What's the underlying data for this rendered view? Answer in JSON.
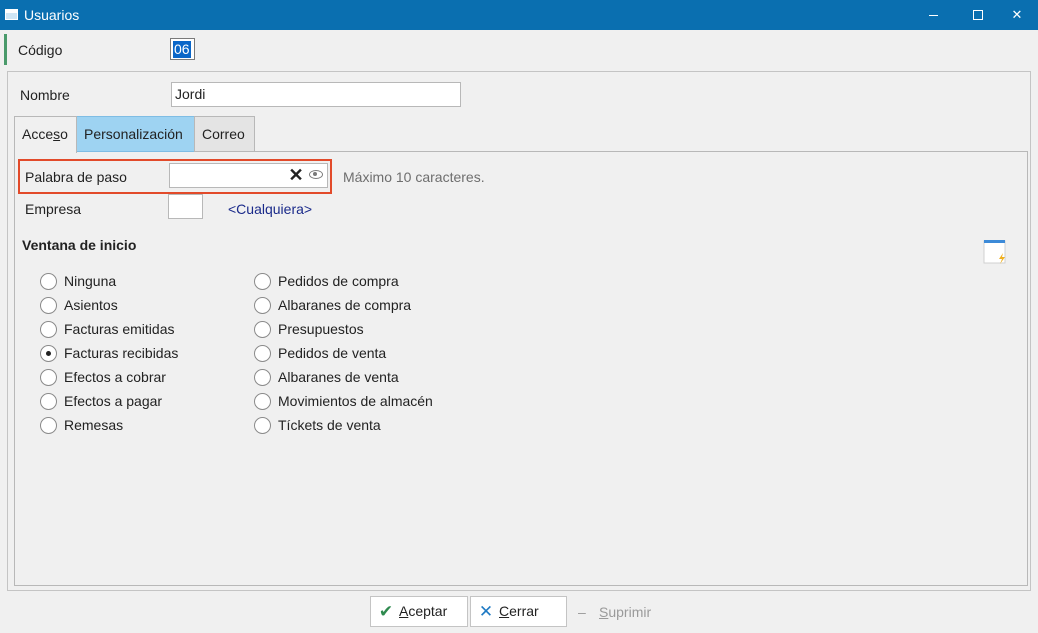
{
  "window": {
    "title": "Usuarios"
  },
  "codigo": {
    "label": "Código",
    "value": "06"
  },
  "nombre": {
    "label": "Nombre",
    "value": "Jordi"
  },
  "tabs": [
    {
      "pre": "Acce",
      "accel": "s",
      "post": "o"
    },
    {
      "label": "Personalización"
    },
    {
      "label": "Correo"
    }
  ],
  "password": {
    "label": "Palabra de paso",
    "value": "",
    "hint": "Máximo 10 caracteres."
  },
  "empresa": {
    "label": "Empresa",
    "value": "<Cualquiera>"
  },
  "inicio": {
    "title": "Ventana de inicio",
    "left": [
      "Ninguna",
      "Asientos",
      "Facturas emitidas",
      "Facturas recibidas",
      "Efectos a cobrar",
      "Efectos a pagar",
      "Remesas"
    ],
    "right": [
      "Pedidos de compra",
      "Albaranes de compra",
      "Presupuestos",
      "Pedidos de venta",
      "Albaranes de venta",
      "Movimientos de almacén",
      "Tíckets de venta"
    ],
    "selected": "Facturas recibidas"
  },
  "footer": {
    "aceptar": {
      "accel": "A",
      "rest": "ceptar"
    },
    "cerrar": {
      "accel": "C",
      "rest": "errar"
    },
    "suprimir": {
      "accel": "S",
      "rest": "uprimir"
    }
  },
  "icons": {
    "clear": "clear-x-icon",
    "reveal": "eye-icon",
    "tool": "edit-panel-icon"
  }
}
